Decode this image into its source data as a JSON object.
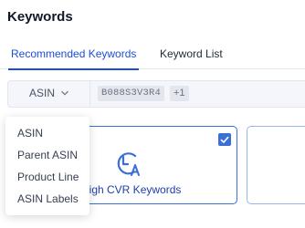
{
  "page": {
    "title": "Keywords"
  },
  "tabs": [
    {
      "label": "Recommended Keywords",
      "active": true
    },
    {
      "label": "Keyword List",
      "active": false
    }
  ],
  "filter": {
    "selected": "ASIN",
    "tags": [
      "B088S3V3R4",
      "+1"
    ]
  },
  "dropdown": {
    "options": [
      "ASIN",
      "Parent ASIN",
      "Product Line",
      "ASIN Labels"
    ]
  },
  "cards": [
    {
      "title": "High CVR Keywords",
      "checked": true,
      "icon": "cvr-icon"
    }
  ],
  "colors": {
    "accent": "#3b6fd8",
    "tab_active": "#1d4ed8"
  }
}
